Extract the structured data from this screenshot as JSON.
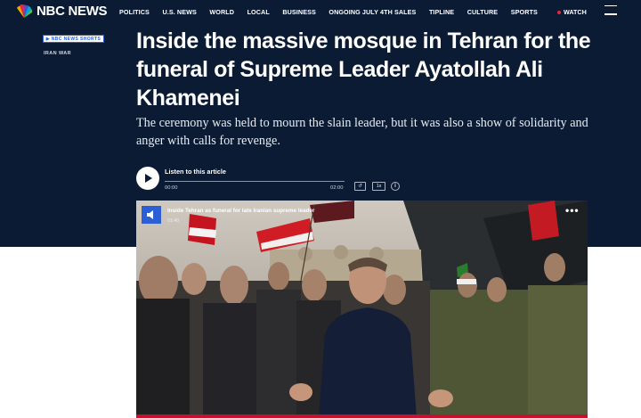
{
  "header": {
    "logo_text": "NBC NEWS",
    "nav": [
      "POLITICS",
      "U.S. NEWS",
      "WORLD",
      "LOCAL",
      "BUSINESS",
      "ONGOING JULY 4TH SALES",
      "TIPLINE",
      "CULTURE",
      "SPORTS"
    ],
    "watch_label": "WATCH",
    "menu_icon": "hamburger-menu-icon"
  },
  "article": {
    "badge_label": "▶ NBC NEWS SHORTS",
    "section": "IRAN WAR",
    "headline": "Inside the massive mosque in Tehran for the funeral of Supreme Leader Ayatollah Ali Khamenei",
    "dek": "The ceremony was held to mourn the slain leader, but it was also a show of solidarity and anger with calls for revenge."
  },
  "audio": {
    "label": "Listen to this article",
    "current_time": "00:00",
    "total_time": "02:00",
    "speed_label": "1x",
    "rewind_label": "↺",
    "info_label": "i",
    "progress": 0
  },
  "video": {
    "title": "Inside Tehran as funeral for late Iranian supreme leader",
    "duration": "01:40",
    "more_label": "•••"
  },
  "colors": {
    "header_bg": "#0b1b33",
    "accent_blue": "#2c5fd6",
    "live_dot": "#e8283b"
  }
}
